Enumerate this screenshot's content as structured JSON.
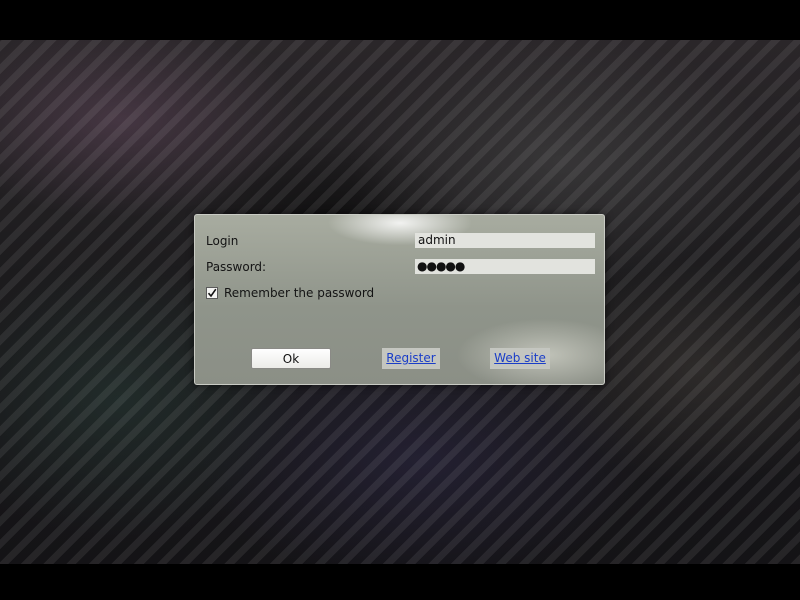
{
  "login_dialog": {
    "login_label": "Login",
    "login_value": "admin",
    "password_label": "Password:",
    "password_value": "●●●●●",
    "remember_label": "Remember the password",
    "remember_checked": true,
    "ok_label": "Ok",
    "register_label": "Register",
    "website_label": "Web site"
  },
  "colors": {
    "link": "#1a3dc8",
    "dialog_bg": "#8f948a",
    "field_bg": "#e2e3de"
  },
  "icons": {
    "checkbox_mark": "checkmark-icon"
  }
}
